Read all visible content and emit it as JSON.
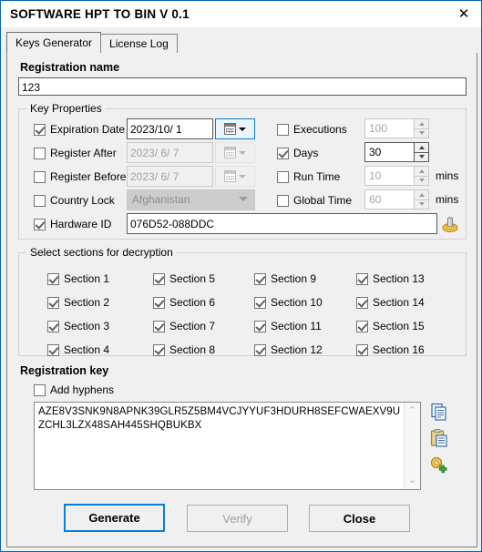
{
  "window": {
    "title": "SOFTWARE HPT TO BIN  V 0.1",
    "close_icon": "close-icon",
    "border_color": "#0a64b4"
  },
  "tabs": [
    {
      "label": "Keys Generator",
      "active": true
    },
    {
      "label": "License Log",
      "active": false
    }
  ],
  "registration_name": {
    "label": "Registration name",
    "value": "123"
  },
  "key_properties": {
    "legend": "Key Properties",
    "left": [
      {
        "label": "Expiration Date",
        "checked": true,
        "value": "2023/10/ 1",
        "enabled": true
      },
      {
        "label": "Register After",
        "checked": false,
        "value": "2023/ 6/ 7",
        "enabled": false
      },
      {
        "label": "Register Before",
        "checked": false,
        "value": "2023/ 6/ 7",
        "enabled": false
      },
      {
        "label": "Country Lock",
        "checked": false,
        "value": "Afghanistan",
        "enabled": false
      },
      {
        "label": "Hardware ID",
        "checked": true,
        "value": "076D52-088DDC",
        "enabled": true
      }
    ],
    "right": [
      {
        "label": "Executions",
        "checked": false,
        "value": "100",
        "enabled": false,
        "unit": ""
      },
      {
        "label": "Days",
        "checked": true,
        "value": "30",
        "enabled": true,
        "unit": ""
      },
      {
        "label": "Run Time",
        "checked": false,
        "value": "10",
        "enabled": false,
        "unit": "mins"
      },
      {
        "label": "Global Time",
        "checked": false,
        "value": "60",
        "enabled": false,
        "unit": "mins"
      }
    ],
    "hardware_key_icon": "key-icon"
  },
  "sections": {
    "legend": "Select sections for decryption",
    "items": [
      {
        "label": "Section 1",
        "checked": true
      },
      {
        "label": "Section 5",
        "checked": true
      },
      {
        "label": "Section 9",
        "checked": true
      },
      {
        "label": "Section 13",
        "checked": true
      },
      {
        "label": "Section 2",
        "checked": true
      },
      {
        "label": "Section 6",
        "checked": true
      },
      {
        "label": "Section 10",
        "checked": true
      },
      {
        "label": "Section 14",
        "checked": true
      },
      {
        "label": "Section 3",
        "checked": true
      },
      {
        "label": "Section 7",
        "checked": true
      },
      {
        "label": "Section 11",
        "checked": true
      },
      {
        "label": "Section 15",
        "checked": true
      },
      {
        "label": "Section 4",
        "checked": true
      },
      {
        "label": "Section 8",
        "checked": true
      },
      {
        "label": "Section 12",
        "checked": true
      },
      {
        "label": "Section 16",
        "checked": true
      }
    ]
  },
  "registration_key": {
    "legend": "Registration key",
    "add_hyphens_label": "Add hyphens",
    "add_hyphens_checked": false,
    "value": "AZE8V3SNK9N8APNK39GLR5Z5BM4VCJYYUF3HDURH8SEFCWAEXV9UZCHL3LZX48SAH445SHQBUKBX",
    "scroll_up": "⌃",
    "scroll_down": "⌄",
    "icons": [
      "copy-icon",
      "paste-icon",
      "add-key-icon"
    ]
  },
  "buttons": {
    "generate": "Generate",
    "verify": "Verify",
    "close": "Close"
  }
}
